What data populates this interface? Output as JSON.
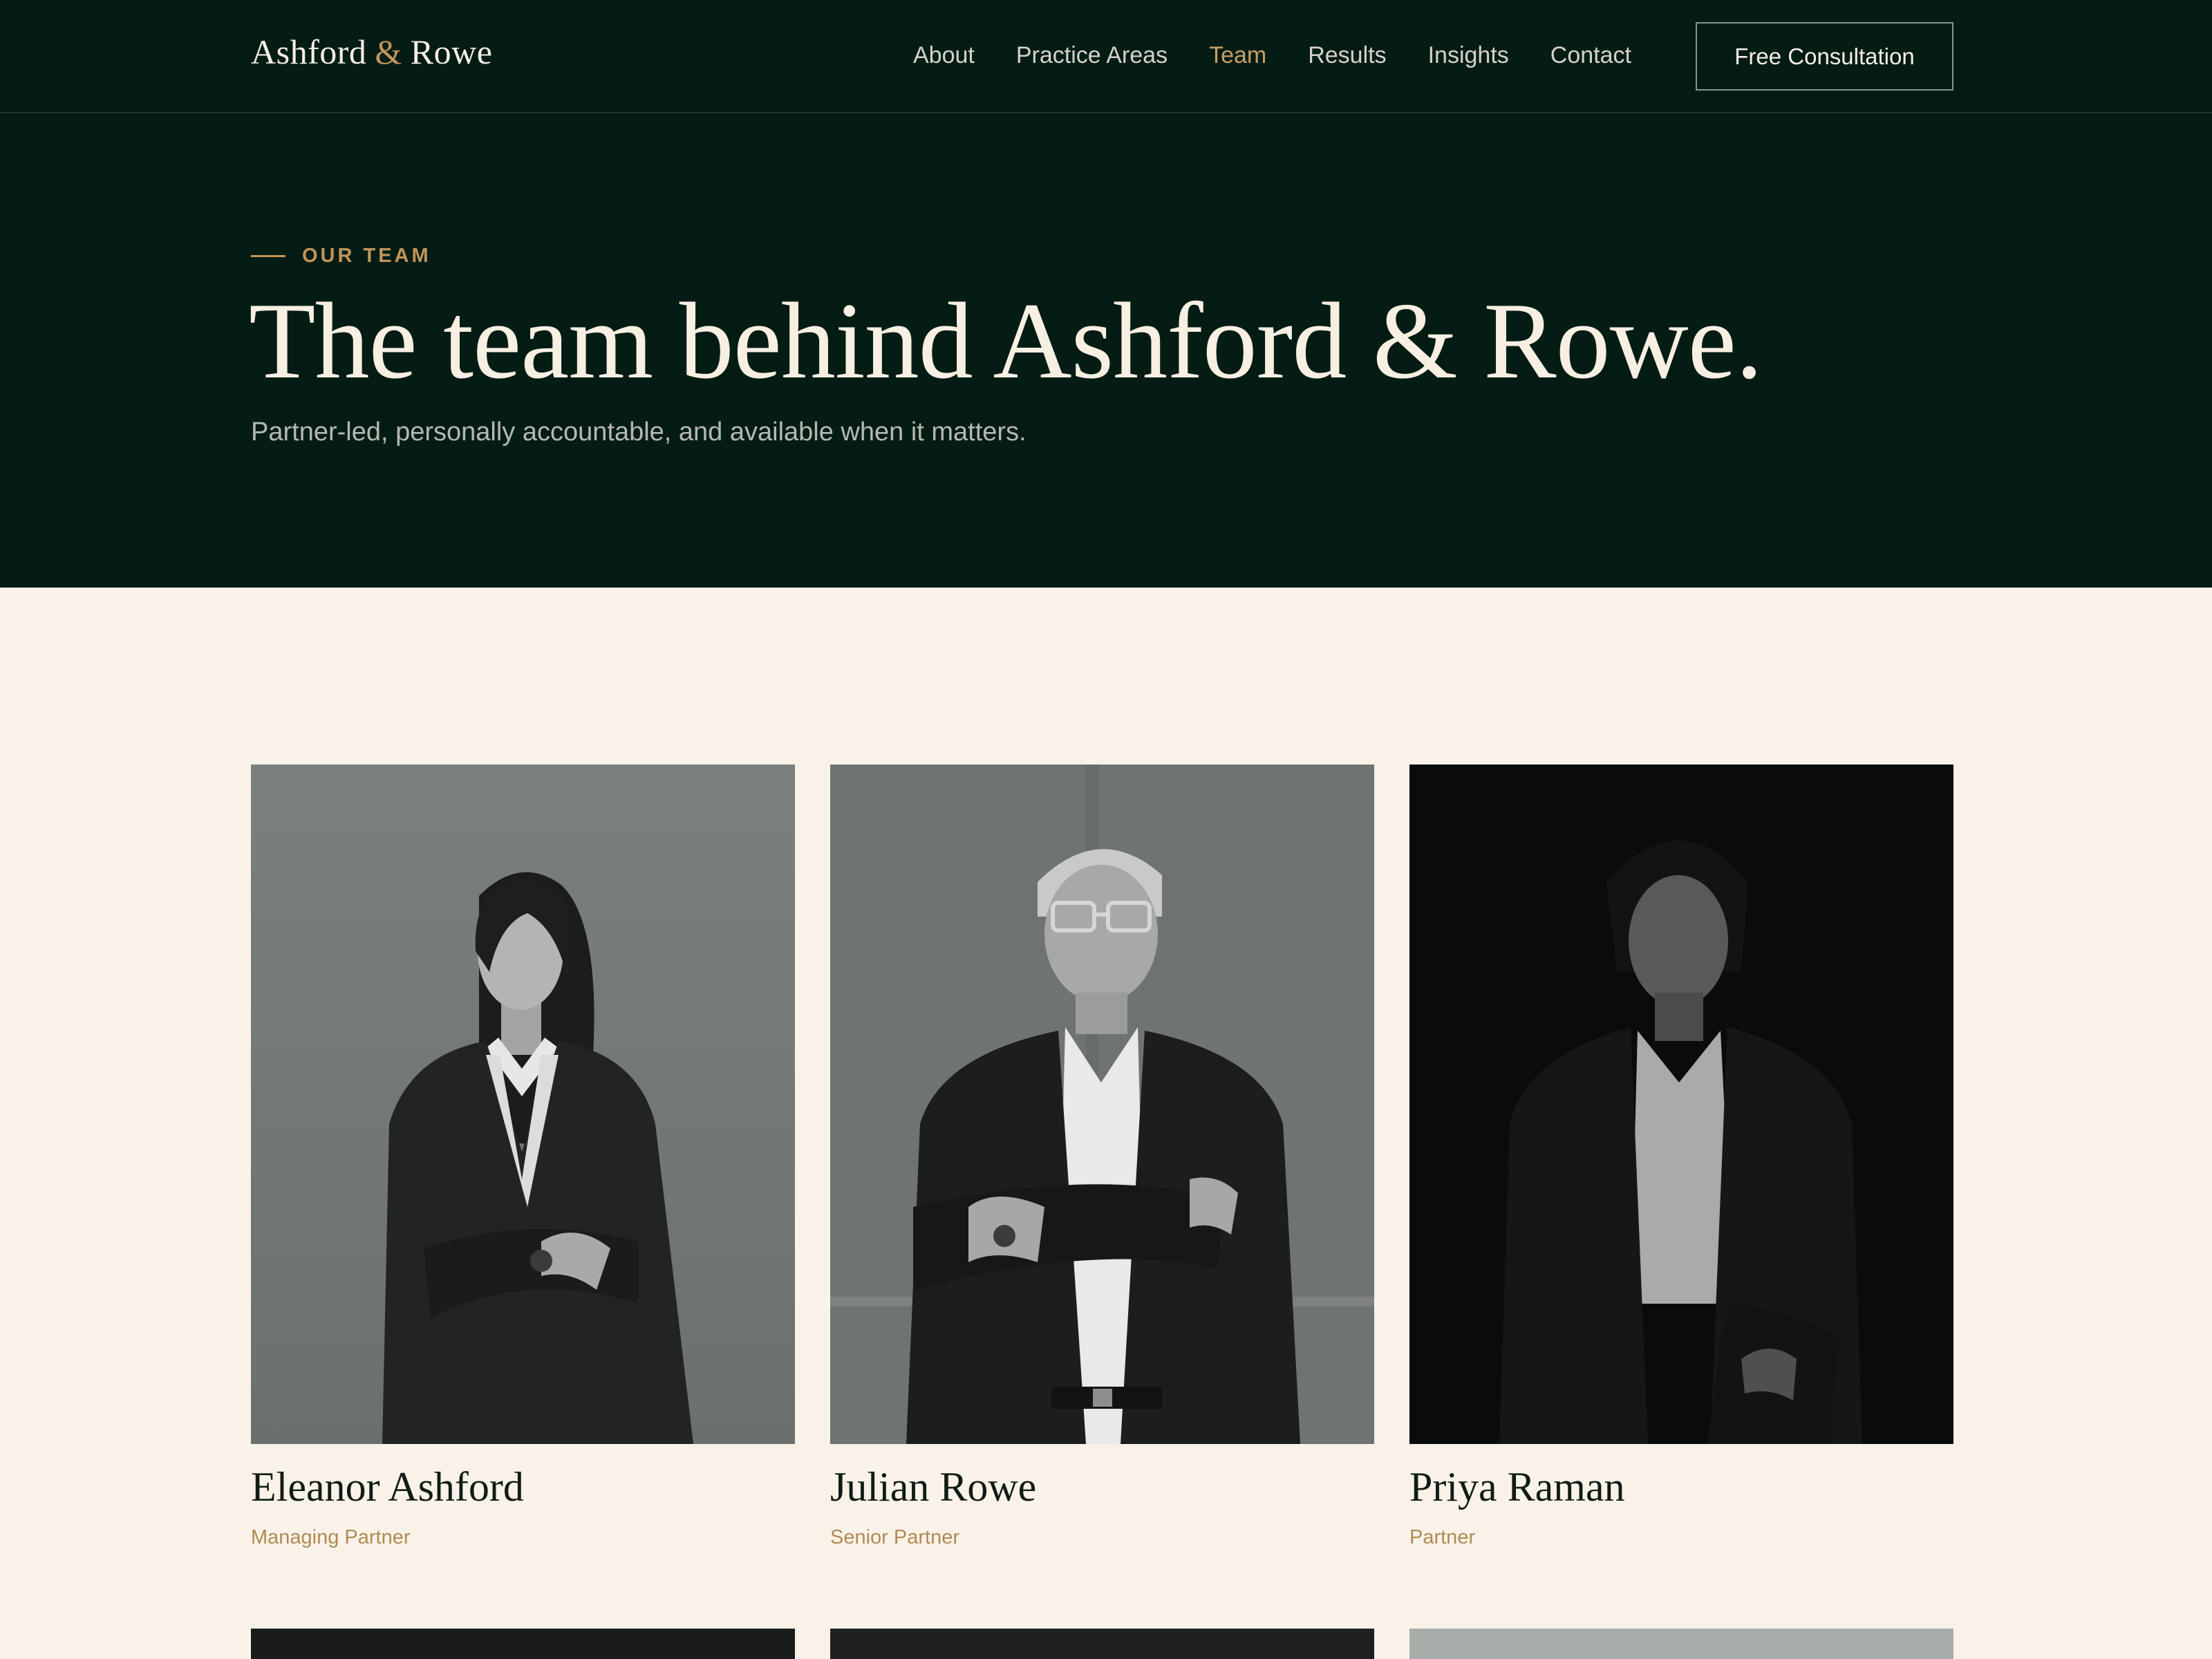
{
  "nav": {
    "logo": {
      "first": "Ashford",
      "amp": "&",
      "last": "Rowe"
    },
    "links": [
      {
        "label": "About"
      },
      {
        "label": "Practice Areas"
      },
      {
        "label": "Team",
        "active": true
      },
      {
        "label": "Results"
      },
      {
        "label": "Insights"
      },
      {
        "label": "Contact"
      }
    ],
    "cta": "Free Consultation"
  },
  "hero": {
    "eyebrow": "OUR TEAM",
    "title": "The team behind Ashford & Rowe.",
    "subtitle": "Partner-led, personally accountable, and available when it matters."
  },
  "team": [
    {
      "name": "Eleanor Ashford",
      "role": "Managing Partner"
    },
    {
      "name": "Julian Rowe",
      "role": "Senior Partner"
    },
    {
      "name": "Priya Raman",
      "role": "Partner"
    }
  ],
  "colors": {
    "dark_green": "#041c14",
    "gold": "#c2955a",
    "cream": "#f9f2e9"
  }
}
